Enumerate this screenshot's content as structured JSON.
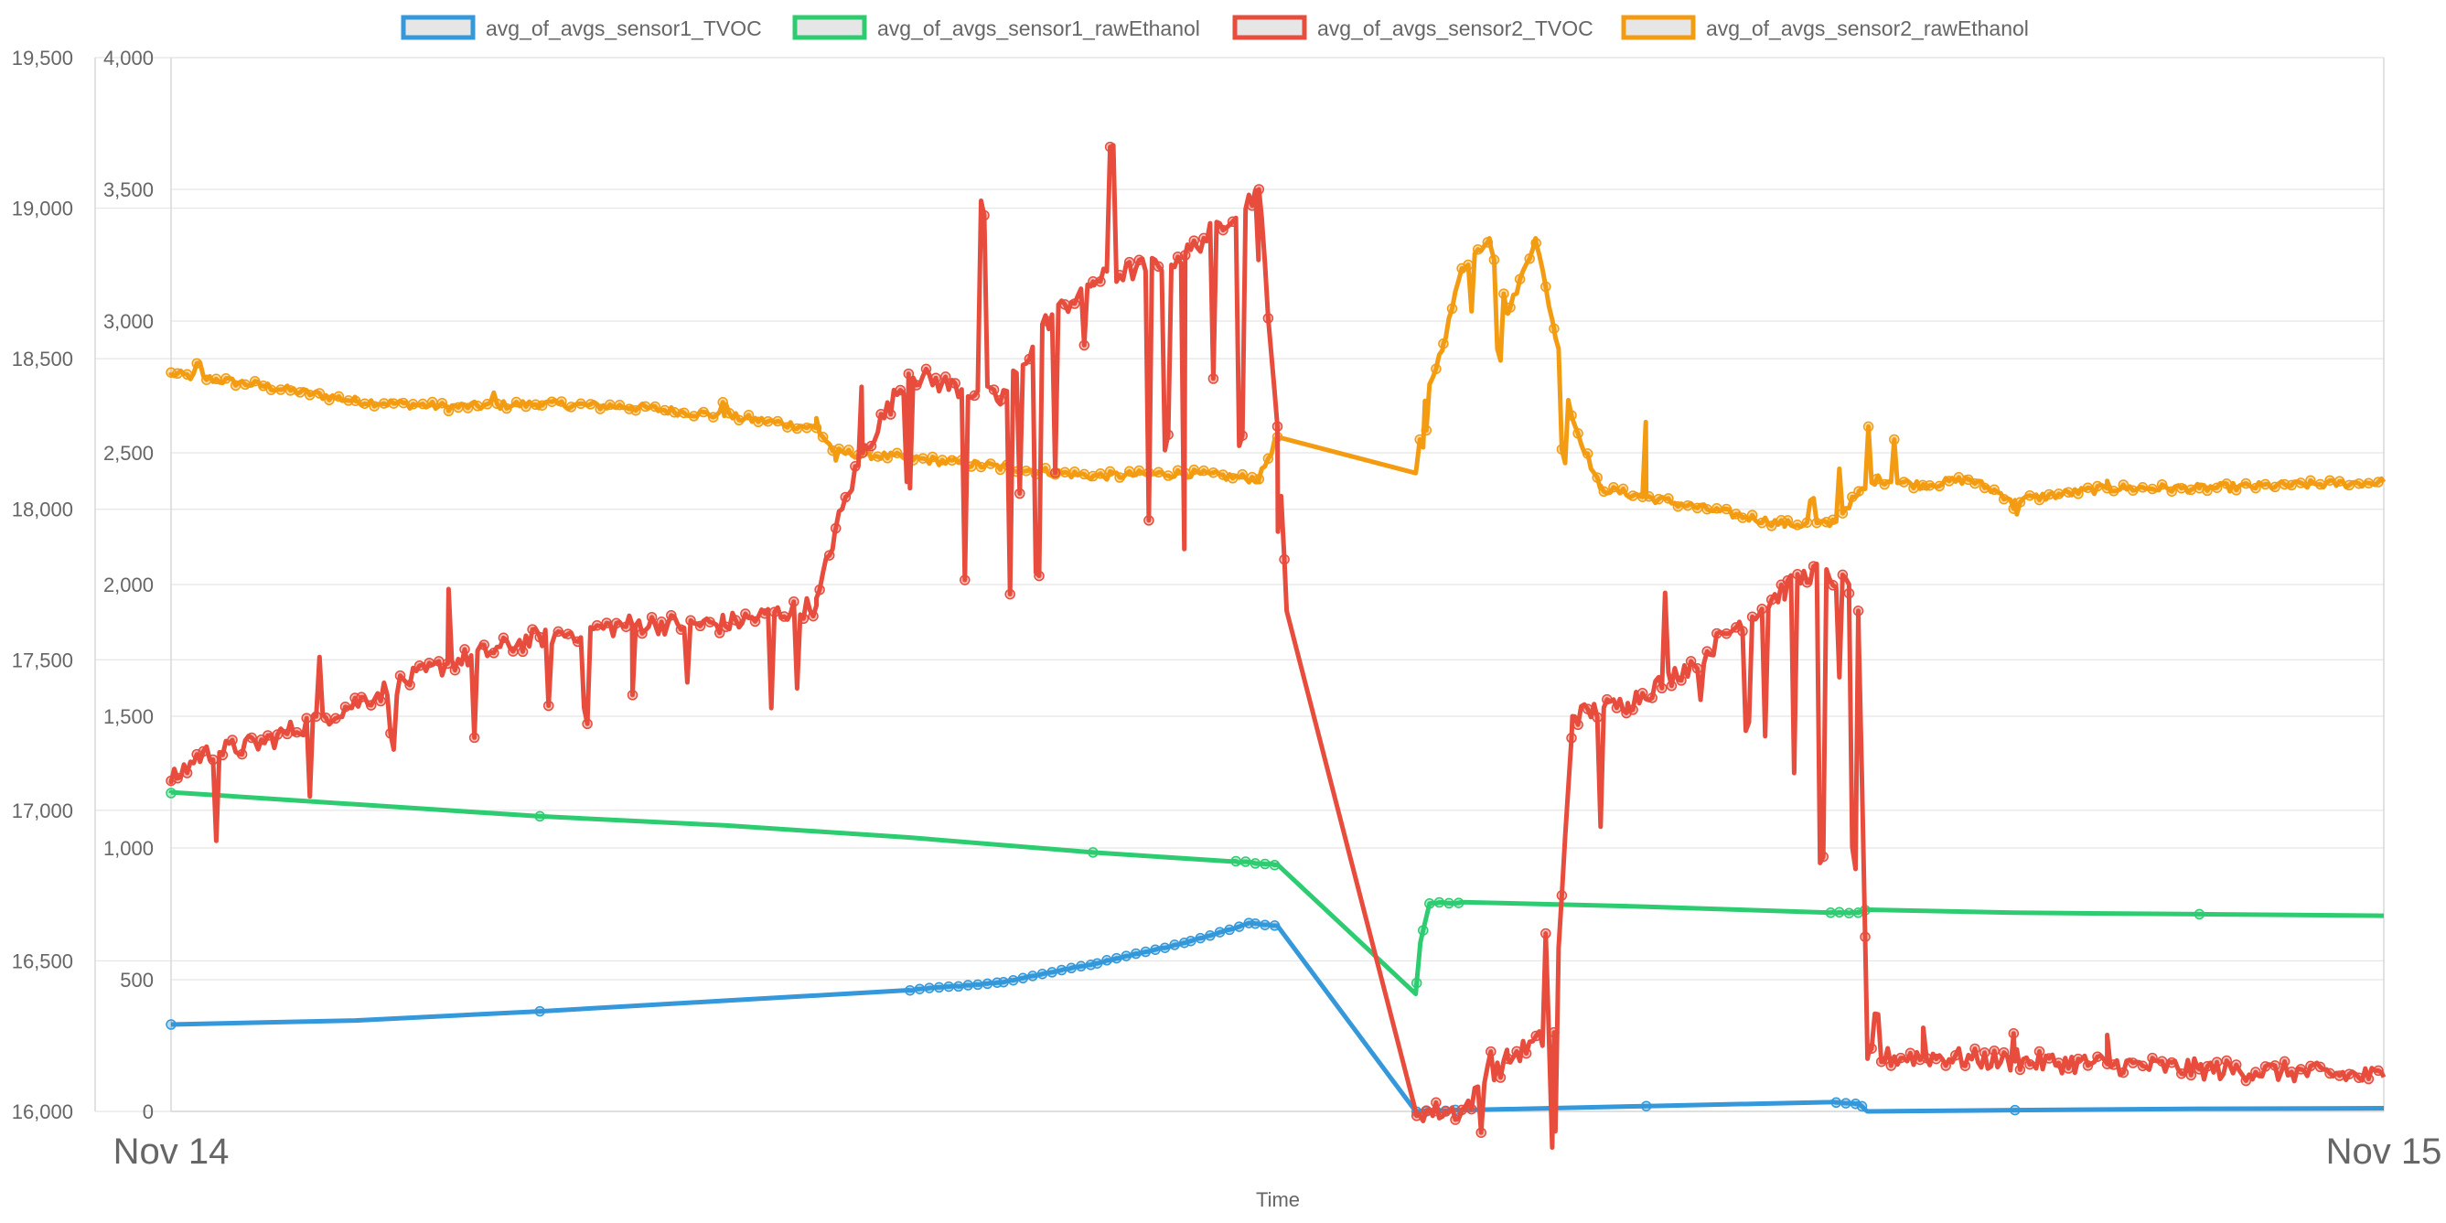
{
  "chart_data": {
    "type": "line",
    "xlabel": "Time",
    "x_ticks": [
      "Nov 14",
      "Nov 15"
    ],
    "y_left_ticks": [
      "19,500",
      "19,000",
      "18,500",
      "18,000",
      "17,500",
      "17,000",
      "16,500",
      "16,000"
    ],
    "y_right_ticks": [
      "4,000",
      "3,500",
      "3,000",
      "2,500",
      "2,000",
      "1,500",
      "1,000",
      "500",
      "0"
    ],
    "y_left_range": [
      16000,
      19500
    ],
    "y_right_range": [
      0,
      4000
    ],
    "x_range": [
      0,
      24
    ],
    "grid": true,
    "legend_position": "top",
    "series": [
      {
        "name": "avg_of_avgs_sensor1_TVOC",
        "color": "#3498db",
        "axis": "right",
        "noise": 2,
        "points": [
          [
            0,
            330
          ],
          [
            2,
            345
          ],
          [
            4,
            380
          ],
          [
            6,
            420
          ],
          [
            8,
            460
          ],
          [
            9,
            490
          ],
          [
            10,
            560
          ],
          [
            11,
            640
          ],
          [
            11.7,
            715
          ],
          [
            12,
            705
          ],
          [
            13.5,
            0
          ],
          [
            14,
            5
          ],
          [
            16,
            20
          ],
          [
            18,
            35
          ],
          [
            18.3,
            30
          ],
          [
            18.4,
            0
          ],
          [
            20,
            5
          ],
          [
            22,
            10
          ],
          [
            24,
            12
          ]
        ]
      },
      {
        "name": "avg_of_avgs_sensor1_rawEthanol",
        "color": "#2ecc71",
        "axis": "left",
        "noise": 3,
        "points": [
          [
            0,
            17060
          ],
          [
            2,
            17020
          ],
          [
            4,
            16980
          ],
          [
            6,
            16950
          ],
          [
            8,
            16910
          ],
          [
            10,
            16860
          ],
          [
            11.5,
            16830
          ],
          [
            12,
            16820
          ],
          [
            13.5,
            16390
          ],
          [
            13.55,
            16560
          ],
          [
            13.65,
            16690
          ],
          [
            14,
            16695
          ],
          [
            16,
            16680
          ],
          [
            18,
            16660
          ],
          [
            18.3,
            16660
          ],
          [
            18.4,
            16670
          ],
          [
            20,
            16660
          ],
          [
            22,
            16655
          ],
          [
            24,
            16650
          ]
        ]
      },
      {
        "name": "avg_of_avgs_sensor2_TVOC",
        "color": "#e74c3c",
        "axis": "right",
        "noise": 40,
        "spikes": [
          [
            0.5,
            -300
          ],
          [
            1.5,
            -250
          ],
          [
            1.6,
            200
          ],
          [
            2.4,
            -200
          ],
          [
            3,
            300
          ],
          [
            3.3,
            -320
          ],
          [
            4.1,
            -300
          ],
          [
            4.5,
            -330
          ],
          [
            5,
            -280
          ],
          [
            5.6,
            -250
          ],
          [
            6.5,
            -350
          ],
          [
            6.8,
            -300
          ],
          [
            7.5,
            250
          ],
          [
            8,
            -400
          ],
          [
            8.6,
            -700
          ],
          [
            8.8,
            700
          ],
          [
            9.1,
            -800
          ],
          [
            9.2,
            -500
          ],
          [
            9.4,
            -900
          ],
          [
            9.6,
            -600
          ],
          [
            9.9,
            -250
          ],
          [
            10.2,
            500
          ],
          [
            10.6,
            -1000
          ],
          [
            10.8,
            -700
          ],
          [
            11,
            -1100
          ],
          [
            11.3,
            -600
          ],
          [
            11.6,
            -900
          ],
          [
            11.8,
            -300
          ],
          [
            12,
            -400
          ],
          [
            14.2,
            -150
          ],
          [
            14.3,
            100
          ],
          [
            14.9,
            400
          ],
          [
            15,
            -450
          ],
          [
            15.5,
            -420
          ],
          [
            16.2,
            300
          ],
          [
            16.6,
            -200
          ],
          [
            17.1,
            -400
          ],
          [
            17.3,
            -500
          ],
          [
            17.6,
            -700
          ],
          [
            17.9,
            -1100
          ],
          [
            18.1,
            -400
          ],
          [
            18.25,
            -1000
          ],
          [
            18.5,
            150
          ],
          [
            19,
            100
          ],
          [
            20,
            80
          ],
          [
            21,
            90
          ]
        ],
        "points": [
          [
            0,
            1250
          ],
          [
            0.3,
            1350
          ],
          [
            1,
            1400
          ],
          [
            2,
            1550
          ],
          [
            3,
            1700
          ],
          [
            4,
            1800
          ],
          [
            5,
            1850
          ],
          [
            6,
            1850
          ],
          [
            7,
            1920
          ],
          [
            7.2,
            2200
          ],
          [
            7.5,
            2500
          ],
          [
            8,
            2800
          ],
          [
            9,
            2700
          ],
          [
            9.5,
            3000
          ],
          [
            10,
            3150
          ],
          [
            11,
            3250
          ],
          [
            11.8,
            3500
          ],
          [
            12,
            2600
          ],
          [
            12.1,
            1900
          ],
          [
            13.5,
            0
          ],
          [
            14,
            0
          ],
          [
            14.5,
            200
          ],
          [
            15,
            300
          ],
          [
            15.2,
            1500
          ],
          [
            15.8,
            1550
          ],
          [
            16.5,
            1700
          ],
          [
            17,
            1850
          ],
          [
            17.5,
            1980
          ],
          [
            17.8,
            2050
          ],
          [
            18.2,
            2000
          ],
          [
            18.3,
            1900
          ],
          [
            18.4,
            200
          ],
          [
            19,
            210
          ],
          [
            20,
            190
          ],
          [
            21,
            180
          ],
          [
            22,
            160
          ],
          [
            23,
            150
          ],
          [
            24,
            130
          ]
        ]
      },
      {
        "name": "avg_of_avgs_sensor2_rawEthanol",
        "color": "#f39c12",
        "axis": "left",
        "noise": 14,
        "spikes": [
          [
            0.3,
            40
          ],
          [
            3.5,
            40
          ],
          [
            6,
            50
          ],
          [
            7,
            30
          ],
          [
            7.2,
            -40
          ],
          [
            12,
            90
          ],
          [
            13.6,
            -120
          ],
          [
            14.1,
            -180
          ],
          [
            14.4,
            -250
          ],
          [
            15.1,
            -260
          ],
          [
            16,
            250
          ],
          [
            17.8,
            80
          ],
          [
            18.1,
            150
          ],
          [
            18.4,
            190
          ],
          [
            18.7,
            150
          ],
          [
            20,
            -40
          ],
          [
            21,
            30
          ]
        ],
        "points": [
          [
            0,
            18450
          ],
          [
            1,
            18410
          ],
          [
            2,
            18360
          ],
          [
            3,
            18340
          ],
          [
            4,
            18350
          ],
          [
            5,
            18340
          ],
          [
            6,
            18310
          ],
          [
            7,
            18270
          ],
          [
            7.2,
            18190
          ],
          [
            8,
            18170
          ],
          [
            9,
            18140
          ],
          [
            10,
            18110
          ],
          [
            11,
            18120
          ],
          [
            11.8,
            18100
          ],
          [
            12,
            18240
          ],
          [
            13.5,
            18120
          ],
          [
            13.6,
            18360
          ],
          [
            13.8,
            18550
          ],
          [
            14,
            18800
          ],
          [
            14.3,
            18900
          ],
          [
            14.5,
            18650
          ],
          [
            14.8,
            18900
          ],
          [
            15,
            18600
          ],
          [
            15.2,
            18300
          ],
          [
            15.5,
            18070
          ],
          [
            16,
            18040
          ],
          [
            17,
            17980
          ],
          [
            17.5,
            17950
          ],
          [
            18,
            17950
          ],
          [
            18.3,
            18050
          ],
          [
            18.5,
            18100
          ],
          [
            19,
            18080
          ],
          [
            19.5,
            18100
          ],
          [
            20,
            18030
          ],
          [
            21,
            18070
          ],
          [
            22,
            18070
          ],
          [
            23,
            18080
          ],
          [
            24,
            18090
          ]
        ]
      }
    ]
  }
}
